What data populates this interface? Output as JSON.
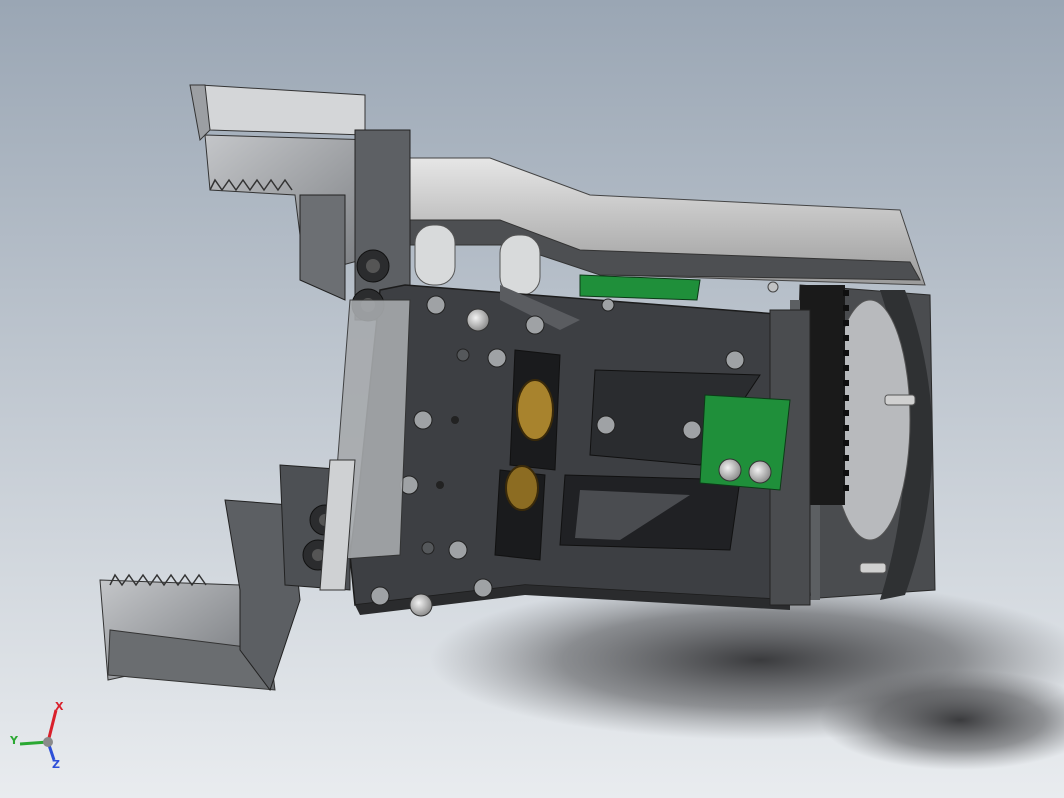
{
  "viewport": {
    "background_top": "#9aa6b4",
    "background_bottom": "#e9ecef"
  },
  "model": {
    "dark_color": "#3b3d40",
    "gray_color": "#8a8d91",
    "light_color": "#c9cbcd",
    "pcb_color": "#1f8f3a",
    "brass_color": "#a8832d"
  },
  "triad": {
    "x_label": "X",
    "y_label": "Y",
    "z_label": "Z",
    "x_color": "#d9202b",
    "y_color": "#2aa832",
    "z_color": "#2d4fd8"
  }
}
